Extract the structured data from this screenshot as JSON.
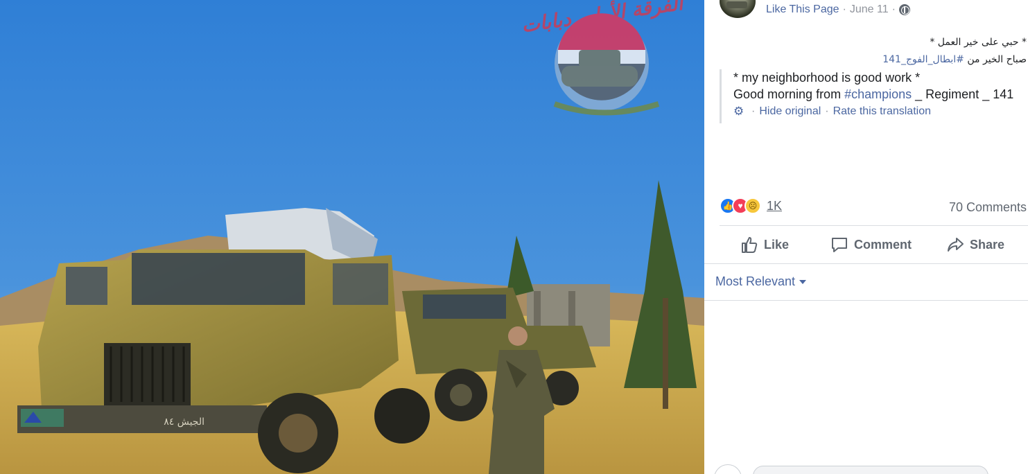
{
  "post": {
    "meta": {
      "page_link": "Like This Page",
      "sep1": "·",
      "date": "June 11",
      "sep2": "·",
      "privacy_icon": "globe-icon"
    },
    "original_text": {
      "line1": "* حبي على خير العمل *",
      "line2_prefix": "صباح الخير من ",
      "line2_tag": "#ابطال_الفوج_141"
    },
    "translation": {
      "line1": "* my neighborhood is good work *",
      "line2_prefix": "Good morning from ",
      "line2_tag": "#champions",
      "line2_suffix": " _ Regiment _ 141",
      "settings_icon": "gear-icon",
      "dot1": "·",
      "hide_original": "Hide original",
      "dot2": "·",
      "rate": "Rate this translation"
    },
    "stats": {
      "reaction_icons": [
        "like-icon",
        "love-icon",
        "sad-icon"
      ],
      "reaction_count": "1K",
      "comments": "70 Comments"
    },
    "actions": {
      "like": "Like",
      "comment": "Comment",
      "share": "Share"
    },
    "sort": {
      "label": "Most Relevant"
    }
  },
  "photo": {
    "watermark_text": "الفرقة الأولى دبابات",
    "truck_plate": "الجيش ٨٤"
  },
  "colors": {
    "link": "#4b67a1",
    "muted": "#90949c",
    "divider": "#dadde1",
    "sky": "#3d86d8"
  }
}
